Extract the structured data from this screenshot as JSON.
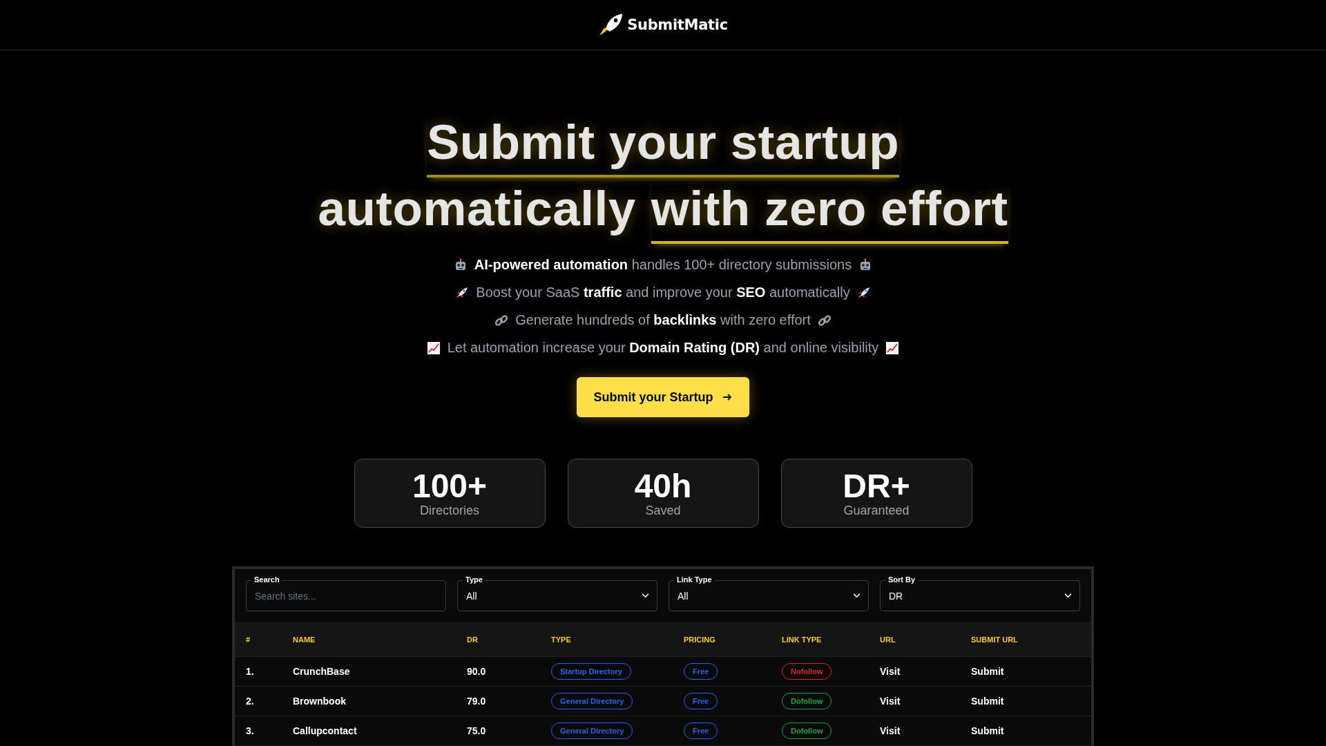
{
  "header": {
    "brand": "SubmitMatic"
  },
  "hero": {
    "title_lines": [
      [
        {
          "text": "Submit your startup",
          "underline": true
        }
      ],
      [
        {
          "text": "automatically",
          "underline": false
        },
        {
          "text": "with zero effort",
          "underline": true
        }
      ]
    ],
    "taglines": [
      {
        "kind": "robot",
        "text": "**AI-powered automation** handles 100+ directory submissions"
      },
      {
        "kind": "rocket",
        "text": "Boost your SaaS **traffic** and improve your **SEO** automatically"
      },
      {
        "kind": "link",
        "text": "Generate hundreds of **backlinks** with zero effort"
      },
      {
        "kind": "chart",
        "text": "Let automation increase your **Domain Rating (DR)** and online visibility"
      }
    ],
    "cta": "Submit your Startup"
  },
  "stats": [
    {
      "value": "100+",
      "label": "Directories"
    },
    {
      "value": "40h",
      "label": "Saved"
    },
    {
      "value": "DR+",
      "label": "Guaranteed"
    }
  ],
  "filters": [
    {
      "label": "Search",
      "kind": "input",
      "placeholder": "Search sites..."
    },
    {
      "label": "Type",
      "kind": "select",
      "value": "All"
    },
    {
      "label": "Link Type",
      "kind": "select",
      "value": "All"
    },
    {
      "label": "Sort By",
      "kind": "select",
      "value": "DR"
    }
  ],
  "table": {
    "columns": [
      "#",
      "NAME",
      "DR",
      "TYPE",
      "PRICING",
      "LINK TYPE",
      "URL",
      "SUBMIT URL"
    ],
    "rows": [
      {
        "num": "1.",
        "name": "CrunchBase",
        "dr": "90.0",
        "type": "Startup Directory",
        "pricing": "Free",
        "link_type": {
          "text": "Nofollow",
          "color": "#dc2626"
        },
        "url": "Visit",
        "submit": "Submit"
      },
      {
        "num": "2.",
        "name": "Brownbook",
        "dr": "79.0",
        "type": "General Directory",
        "pricing": "Free",
        "link_type": {
          "text": "Dofollow",
          "color": "#16a34a"
        },
        "url": "Visit",
        "submit": "Submit"
      },
      {
        "num": "3.",
        "name": "Callupcontact",
        "dr": "75.0",
        "type": "General Directory",
        "pricing": "Free",
        "link_type": {
          "text": "Dofollow",
          "color": "#16a34a"
        },
        "url": "Visit",
        "submit": "Submit"
      }
    ]
  }
}
